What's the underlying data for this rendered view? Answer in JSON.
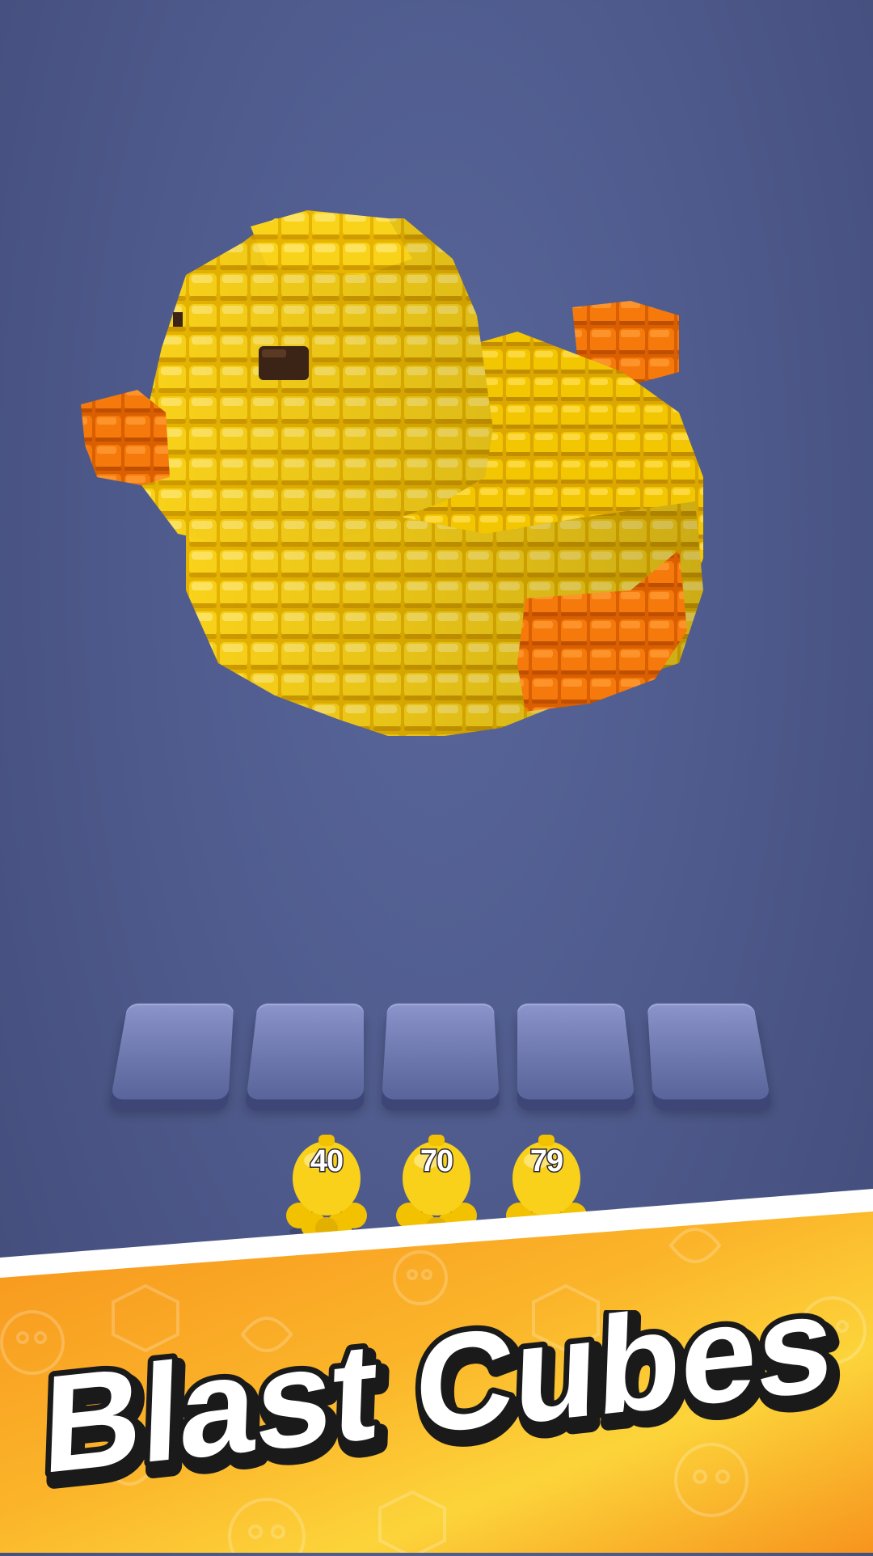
{
  "game": {
    "title_text": "Blast Cubes",
    "shooters": [
      {
        "count": "40"
      },
      {
        "count": "70"
      },
      {
        "count": "79"
      }
    ],
    "slots_count": 5
  },
  "colors": {
    "background": "#4f5b8d",
    "cube_yellow": "#f4c400",
    "cube_orange": "#f07800",
    "eye": "#3b2416",
    "slot": "#7580b8",
    "banner_orange": "#f7941d",
    "banner_yellow": "#fcd43a",
    "title_fill": "#ffffff",
    "title_outline": "#1a1a1a"
  },
  "icons": {
    "model": "rubber-duck-voxel",
    "shooter": "yellow-blob-shooter-icon",
    "banner_pattern": "doodle-pattern"
  }
}
